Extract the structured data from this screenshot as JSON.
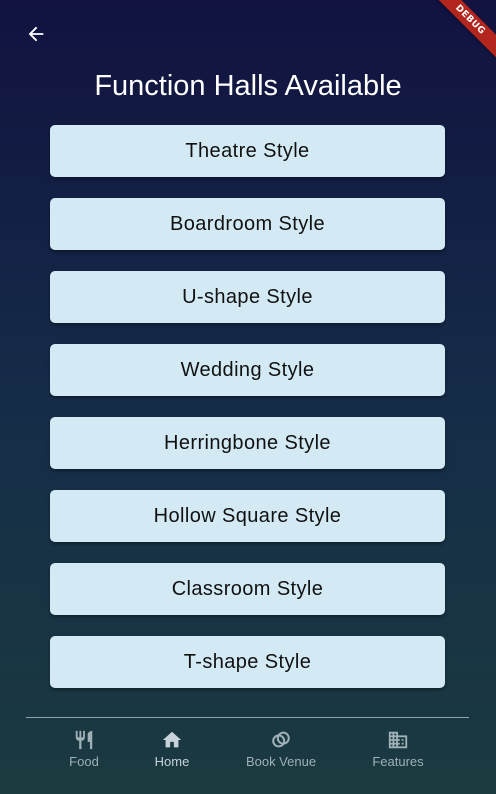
{
  "header": {
    "back_icon": "arrow-left-icon",
    "title": "Function Halls Available",
    "debug_banner": "DEBUG"
  },
  "halls": [
    {
      "label": "Theatre Style"
    },
    {
      "label": "Boardroom Style"
    },
    {
      "label": "U-shape Style"
    },
    {
      "label": "Wedding Style"
    },
    {
      "label": "Herringbone Style"
    },
    {
      "label": "Hollow Square Style"
    },
    {
      "label": "Classroom Style"
    },
    {
      "label": "T-shape Style"
    }
  ],
  "bottom_nav": {
    "items": [
      {
        "label": "Food",
        "icon": "restaurant-icon"
      },
      {
        "label": "Home",
        "icon": "home-icon"
      },
      {
        "label": "Book Venue",
        "icon": "rings-icon"
      },
      {
        "label": "Features",
        "icon": "building-icon"
      }
    ]
  },
  "colors": {
    "background_top": "#111240",
    "background_bottom": "#1a3a40",
    "button_bg": "#d3eaf5",
    "button_text": "#111111",
    "nav_text": "#9fb0b6",
    "debug_banner": "#b3261e"
  }
}
